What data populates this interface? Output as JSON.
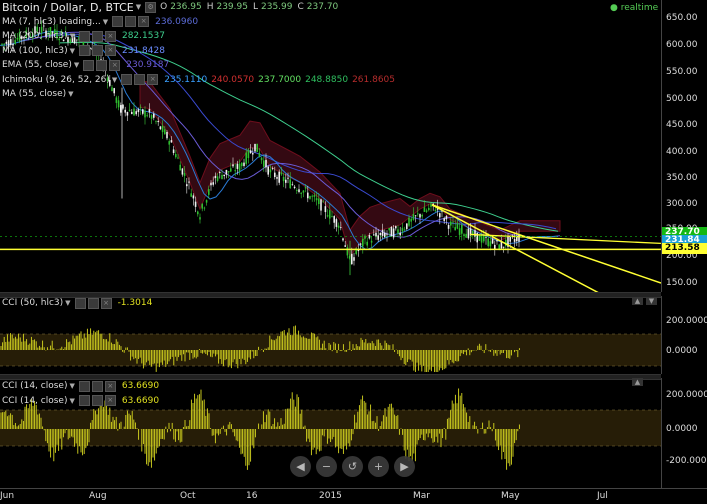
{
  "header": {
    "symbol": "Bitcoin / Dollar, D, BTCE",
    "ohlc": {
      "o_label": "O",
      "o": "236.95",
      "h_label": "H",
      "h": "239.95",
      "l_label": "L",
      "l": "235.99",
      "c_label": "C",
      "c": "237.70"
    },
    "realtime": "realtime"
  },
  "indicators": [
    {
      "label": "MA (7, hlc3) loading...",
      "value": "236.0960",
      "color": "#5b6bd6"
    },
    {
      "label": "MA (200, hlc3)",
      "value": "282.1537",
      "color": "#3ecf8e"
    },
    {
      "label": "MA (100, hlc3)",
      "value": "231.8428",
      "color": "#6b8cff"
    },
    {
      "label": "EMA (55, close)",
      "value": "230.9187",
      "color": "#6b5bd6"
    },
    {
      "label": "Ichimoku (9, 26, 52, 26)",
      "values": [
        "235.1110",
        "240.0570",
        "237.7000",
        "248.8850",
        "261.8605"
      ],
      "colors": [
        "#3aa0ff",
        "#d03030",
        "#62e062",
        "#2fbf5f",
        "#b52c2c"
      ]
    },
    {
      "label": "MA (55, close)",
      "value": "",
      "color": "#aaa"
    }
  ],
  "price_scale": {
    "ticks": [
      "650.00",
      "600.00",
      "550.00",
      "500.00",
      "450.00",
      "400.00",
      "350.00",
      "300.00",
      "250.00",
      "200.00",
      "150.00"
    ],
    "tags": [
      {
        "text": "237.70",
        "bg": "#14b814",
        "fg": "#fff"
      },
      {
        "text": "231.84",
        "bg": "#1aa1d6",
        "fg": "#fff"
      },
      {
        "text": "213.58",
        "bg": "#ffff33",
        "fg": "#000"
      }
    ]
  },
  "cci_panel_1": {
    "label": "CCI (50, hlc3)",
    "value": "-1.3014",
    "ticks": [
      "200.0000",
      "0.0000"
    ]
  },
  "cci_panel_2": {
    "labels": [
      "CCI (14, close)",
      "CCI (14, close)"
    ],
    "values": [
      "63.6690",
      "63.6690"
    ],
    "ticks": [
      "200.0000",
      "0.0000",
      "-200.0000"
    ]
  },
  "time_axis": {
    "labels": [
      "Jun",
      "Aug",
      "Oct",
      "16",
      "2015",
      "Mar",
      "May",
      "Jul"
    ]
  },
  "nav": {
    "scroll_left": "◀",
    "zoom_out": "−",
    "reset": "↺",
    "zoom_in": "+",
    "scroll_right": "▶"
  },
  "chart_data": {
    "type": "line",
    "title": "Bitcoin / Dollar, D, BTCE",
    "ylim": [
      130,
      670
    ],
    "x": [
      "Jun",
      "Aug",
      "Oct",
      "16",
      "2015",
      "Mar",
      "May"
    ],
    "series": [
      {
        "name": "Bitcoin / Dollar, D, BTCE",
        "values": [
          640,
          600,
          380,
          350,
          200,
          270,
          237.7
        ]
      }
    ],
    "horizontal_lines": [
      213.58
    ]
  }
}
